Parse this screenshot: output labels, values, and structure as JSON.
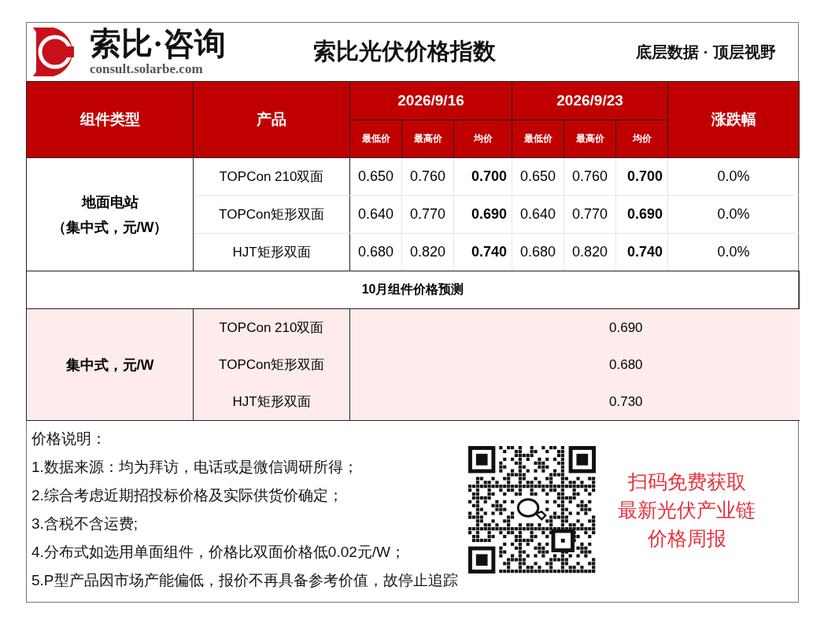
{
  "header": {
    "brand": "索比·咨询",
    "url": "consult.solarbe.com",
    "title": "索比光伏价格指数",
    "slogan": "底层数据 · 顶层视野"
  },
  "table": {
    "type_header": "组件类型",
    "product_header": "产品",
    "date_groups": [
      {
        "date": "2026/9/16",
        "subcolumns": [
          "最低价",
          "最高价",
          "均价"
        ]
      },
      {
        "date": "2026/9/23",
        "subcolumns": [
          "最低价",
          "最高价",
          "均价"
        ]
      }
    ],
    "change_header": "涨跌幅",
    "category_lines": [
      "地面电站",
      "（集中式，元/W）"
    ],
    "rows": [
      {
        "product": "TOPCon 210双面",
        "values": [
          "0.650",
          "0.760",
          "0.700",
          "0.650",
          "0.760",
          "0.700"
        ],
        "change": "0.0%"
      },
      {
        "product": "TOPCon矩形双面",
        "values": [
          "0.640",
          "0.770",
          "0.690",
          "0.640",
          "0.770",
          "0.690"
        ],
        "change": "0.0%"
      },
      {
        "product": "HJT矩形双面",
        "values": [
          "0.680",
          "0.820",
          "0.740",
          "0.680",
          "0.820",
          "0.740"
        ],
        "change": "0.0%"
      }
    ]
  },
  "forecast": {
    "title": "10月组件价格预测",
    "category": "集中式，元/W",
    "rows": [
      {
        "product": "TOPCon 210双面",
        "value": "0.690"
      },
      {
        "product": "TOPCon矩形双面",
        "value": "0.680"
      },
      {
        "product": "HJT矩形双面",
        "value": "0.730"
      }
    ]
  },
  "notes": {
    "title": "价格说明：",
    "items": [
      "1.数据来源：均为拜访，电话或是微信调研所得；",
      "2.综合考虑近期招投标价格及实际供货价确定；",
      "3.含税不含运费;",
      "4.分布式如选用单面组件，价格比双面价格低0.02元/W；",
      "5.P型产品因市场产能偏低，报价不再具备参考价值，故停止追踪"
    ]
  },
  "promo": {
    "lines": [
      "扫码免费获取",
      "最新光伏产业链",
      "价格周报"
    ]
  }
}
